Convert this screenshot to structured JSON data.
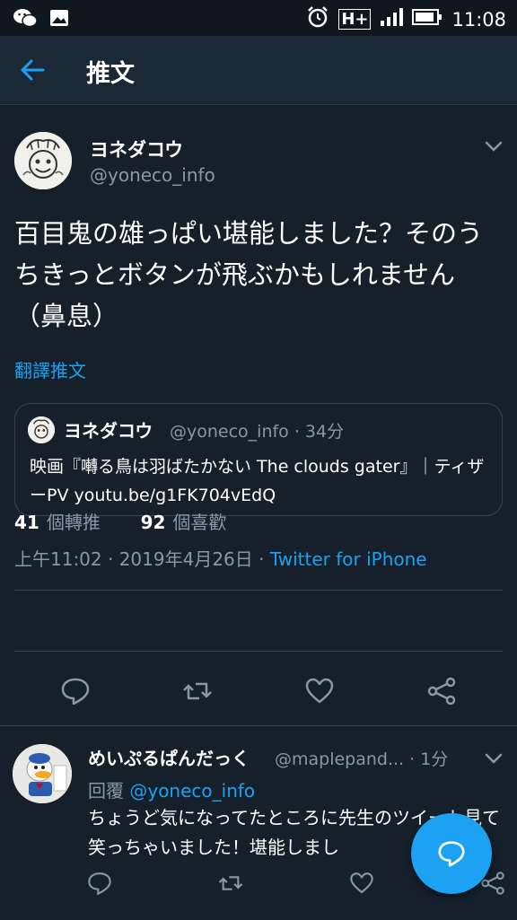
{
  "status_bar": {
    "time": "11:08",
    "icons": [
      "wechat-icon",
      "gallery-icon",
      "alarm-icon",
      "network-h-plus-icon",
      "signal-icon",
      "battery-icon"
    ],
    "network_label": "H+"
  },
  "app_bar": {
    "back_icon": "arrow-left-icon",
    "title": "推文"
  },
  "tweet": {
    "author_name": "ヨネダコウ",
    "author_handle": "@yoneco_info",
    "text": "百目鬼の雄っぱい堪能しました？そのうちきっとボタンが飛ぶかもしれません（鼻息）",
    "translate_label": "翻譯推文",
    "quote": {
      "author_name": "ヨネダコウ",
      "meta": "@yoneco_info · 34分",
      "text": "映画『囀る鳥は羽ばたかない The clouds gater』｜ティザーPV youtu.be/g1FK704vEdQ"
    },
    "timestamp": "上午11:02 · 2019年4月26日 · ",
    "client": "Twitter for iPhone",
    "stats": {
      "retweets_count": "41",
      "retweets_label": "個轉推",
      "likes_count": "92",
      "likes_label": "個喜歡"
    }
  },
  "reply": {
    "author_name": "めいぷるぱんだっく",
    "meta": "@maplepand... · 1分",
    "replying_to_label": "回覆 ",
    "replying_to_mention": "@yoneco_info",
    "text": "ちょうど気になってたところに先生のツイート見て笑っちゃいました！堪能しまし"
  },
  "colors": {
    "background": "#15202b",
    "app_bar": "#1b2836",
    "accent": "#1da1f2",
    "secondary_text": "#8899a6",
    "divider": "#38444d"
  }
}
